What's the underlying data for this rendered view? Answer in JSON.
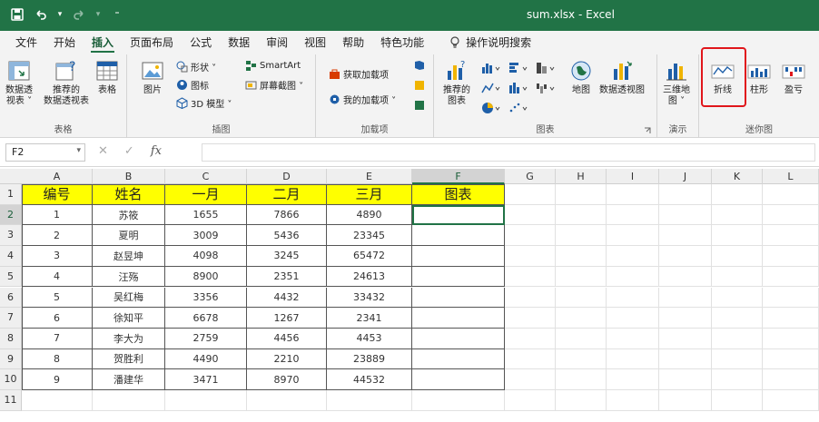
{
  "app": {
    "title": "sum.xlsx  -  Excel"
  },
  "qat": {
    "save_icon": "save-icon",
    "undo_icon": "undo-icon",
    "redo_icon": "redo-icon",
    "customize_icon": "customize-icon"
  },
  "tabs": [
    {
      "label": "文件"
    },
    {
      "label": "开始"
    },
    {
      "label": "插入"
    },
    {
      "label": "页面布局"
    },
    {
      "label": "公式"
    },
    {
      "label": "数据"
    },
    {
      "label": "审阅"
    },
    {
      "label": "视图"
    },
    {
      "label": "帮助"
    },
    {
      "label": "特色功能"
    }
  ],
  "search_label": "操作说明搜索",
  "ribbon": {
    "tables": {
      "label": "表格",
      "pivot": "数据透\n视表 ˅",
      "recommended_pivot": "推荐的\n数据透视表",
      "table": "表格"
    },
    "illustrations": {
      "label": "插图",
      "pictures": "图片",
      "shapes": "形状 ˅",
      "icons": "图标",
      "model3d": "3D 模型 ˅",
      "smartart": "SmartArt",
      "screenshot": "屏幕截图 ˅"
    },
    "addins": {
      "label": "加载项",
      "get": "获取加载项",
      "mine": "我的加载项 ˅"
    },
    "charts": {
      "label": "图表",
      "recommended": "推荐的\n图表",
      "map": "地图",
      "pivot_chart": "数据透视图"
    },
    "tours": {
      "label": "演示",
      "map3d": "三维地\n图 ˅"
    },
    "sparklines": {
      "label": "迷你图",
      "line": "折线",
      "column": "柱形",
      "winloss": "盈亏"
    }
  },
  "formula_bar": {
    "name_box": "F2",
    "fx": "fx",
    "value": ""
  },
  "columns": [
    "A",
    "B",
    "C",
    "D",
    "E",
    "F",
    "G",
    "H",
    "I",
    "J",
    "K",
    "L"
  ],
  "rows": [
    "1",
    "2",
    "3",
    "4",
    "5",
    "6",
    "7",
    "8",
    "9",
    "10",
    "11"
  ],
  "table": {
    "headers": [
      "编号",
      "姓名",
      "一月",
      "二月",
      "三月",
      "图表"
    ],
    "rows": [
      [
        "1",
        "苏筱",
        "1655",
        "7866",
        "4890",
        ""
      ],
      [
        "2",
        "夏明",
        "3009",
        "5436",
        "23345",
        ""
      ],
      [
        "3",
        "赵昱坤",
        "4098",
        "3245",
        "65472",
        ""
      ],
      [
        "4",
        "汪殇",
        "8900",
        "2351",
        "24613",
        ""
      ],
      [
        "5",
        "吴红梅",
        "3356",
        "4432",
        "33432",
        ""
      ],
      [
        "6",
        "徐知平",
        "6678",
        "1267",
        "2341",
        ""
      ],
      [
        "7",
        "李大为",
        "2759",
        "4456",
        "4453",
        ""
      ],
      [
        "8",
        "贺胜利",
        "4490",
        "2210",
        "23889",
        ""
      ],
      [
        "9",
        "潘建华",
        "3471",
        "8970",
        "44532",
        ""
      ]
    ]
  },
  "colors": {
    "accent": "#217346",
    "header_fill": "#ffff00",
    "highlight": "#e0161b"
  }
}
